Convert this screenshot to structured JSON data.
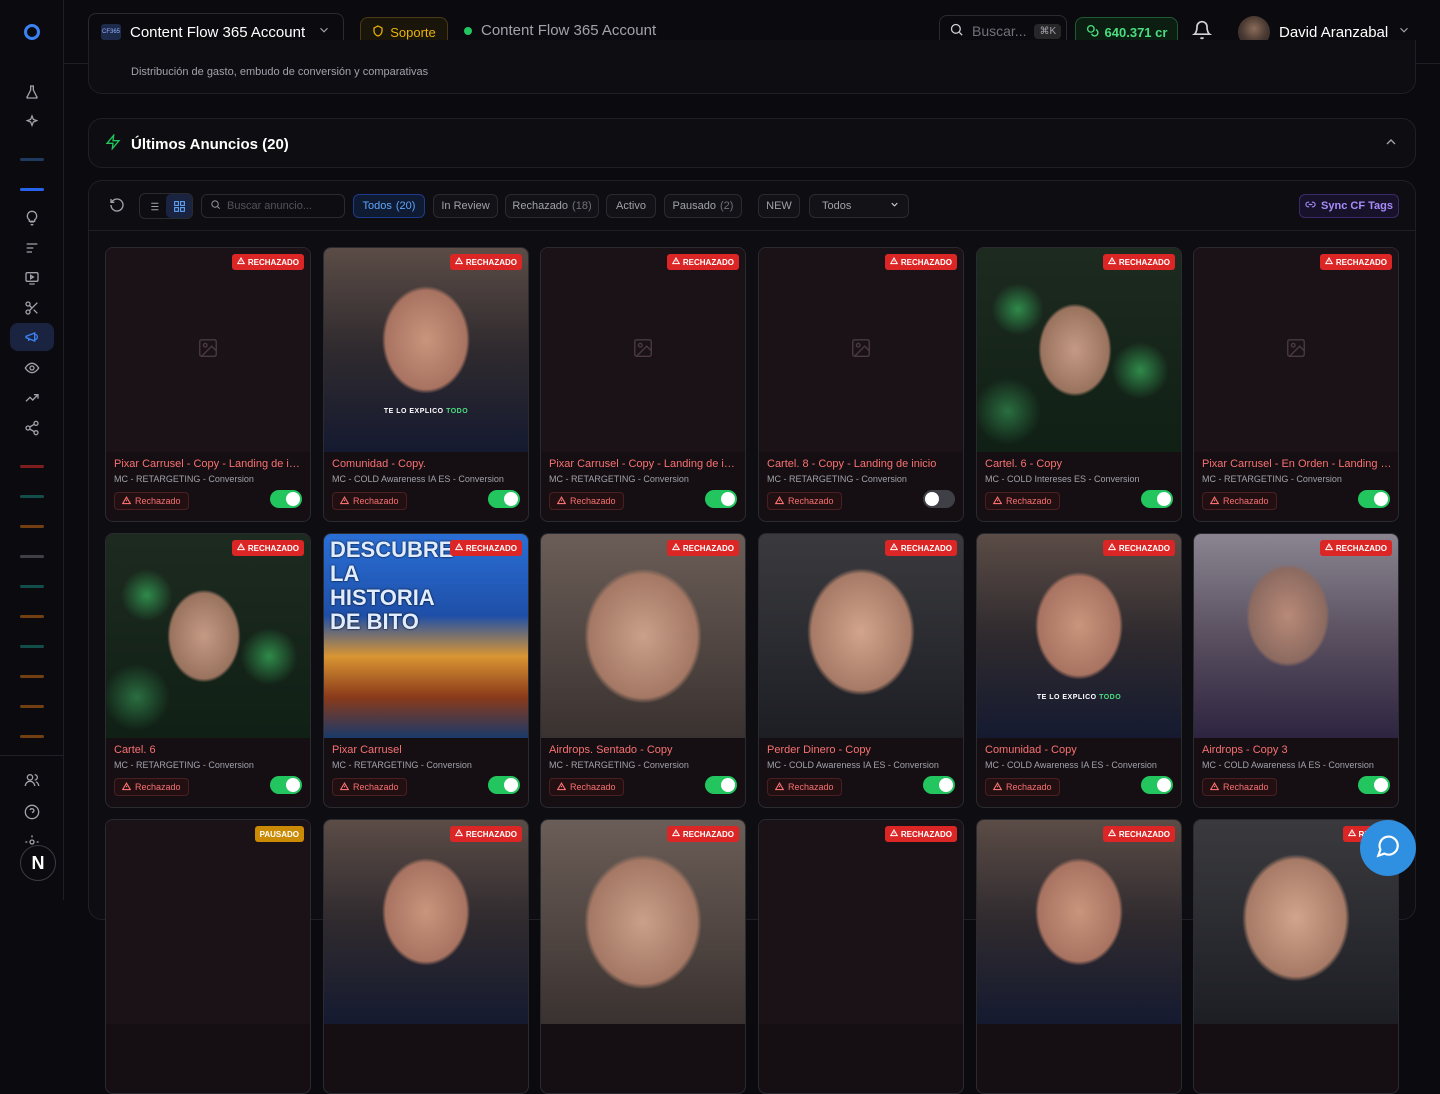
{
  "topbar": {
    "account_name": "Content Flow 365 Account",
    "account_logo_text": "CF365",
    "support_label": "Soporte",
    "account_status": "Content Flow 365 Account",
    "search_placeholder": "Buscar...",
    "search_shortcut": "⌘K",
    "credits": "640.371 cr",
    "user_name": "David Aranzabal"
  },
  "sidebar": {
    "avatar_initial": "N",
    "items": [
      "flask-icon",
      "sparkles-icon",
      "lightbulb-icon",
      "list-icon",
      "monitor-play-icon",
      "scissors-icon",
      "megaphone-icon",
      "eye-icon",
      "trending-icon",
      "share-icon",
      "users-icon",
      "help-icon",
      "settings-icon"
    ],
    "dash_colors": [
      "#1e3a5f",
      "#2563eb",
      "#7f1d1d",
      "#134e4a",
      "#713f12",
      "#3f3f46",
      "#134e4a",
      "#713f12",
      "#134e4a",
      "#713f12",
      "#713f12",
      "#713f12"
    ]
  },
  "prev_section": {
    "subtitle": "Distribución de gasto, embudo de conversión y comparativas"
  },
  "ads_section": {
    "title": "Últimos Anuncios (20)"
  },
  "filters": {
    "search_placeholder": "Buscar anuncio...",
    "tabs": [
      {
        "label": "Todos",
        "count": "(20)",
        "active": true
      },
      {
        "label": "In Review",
        "count": "",
        "active": false
      },
      {
        "label": "Rechazado",
        "count": "(18)",
        "active": false
      },
      {
        "label": "Activo",
        "count": "",
        "active": false
      },
      {
        "label": "Pausado",
        "count": "(2)",
        "active": false
      }
    ],
    "new_label": "NEW",
    "select_value": "Todos",
    "sync_label": "Sync CF Tags"
  },
  "status_labels": {
    "rejected_badge": "RECHAZADO",
    "paused_badge": "PAUSADO",
    "rejected_chip": "Rechazado"
  },
  "ads": [
    {
      "name": "Pixar Carrusel - Copy - Landing de in...",
      "campaign": "MC - RETARGETING - Conversion",
      "status": "Rechazado",
      "badge": "RECHAZADO",
      "enabled": true,
      "thumb": "placeholder",
      "caption": ""
    },
    {
      "name": "Comunidad - Copy.",
      "campaign": "MC - COLD Awareness IA ES - Conversion",
      "status": "Rechazado",
      "badge": "RECHAZADO",
      "enabled": true,
      "thumb": "video-a",
      "caption": "TE LO EXPLICO TODO"
    },
    {
      "name": "Pixar Carrusel - Copy - Landing de in...",
      "campaign": "MC - RETARGETING - Conversion",
      "status": "Rechazado",
      "badge": "RECHAZADO",
      "enabled": true,
      "thumb": "placeholder",
      "caption": ""
    },
    {
      "name": "Cartel. 8 - Copy - Landing de inicio",
      "campaign": "MC - RETARGETING - Conversion",
      "status": "Rechazado",
      "badge": "RECHAZADO",
      "enabled": false,
      "thumb": "placeholder",
      "caption": ""
    },
    {
      "name": "Cartel. 6 - Copy",
      "campaign": "MC - COLD Intereses ES - Conversion",
      "status": "Rechazado",
      "badge": "RECHAZADO",
      "enabled": true,
      "thumb": "video-b",
      "caption": ""
    },
    {
      "name": "Pixar Carrusel - En Orden - Landing d...",
      "campaign": "MC - RETARGETING - Conversion",
      "status": "Rechazado",
      "badge": "RECHAZADO",
      "enabled": true,
      "thumb": "placeholder",
      "caption": ""
    },
    {
      "name": "Cartel. 6",
      "campaign": "MC - RETARGETING - Conversion",
      "status": "Rechazado",
      "badge": "RECHAZADO",
      "enabled": true,
      "thumb": "video-b",
      "caption": ""
    },
    {
      "name": "Pixar Carrusel",
      "campaign": "MC - RETARGETING - Conversion",
      "status": "Rechazado",
      "badge": "RECHAZADO",
      "enabled": true,
      "thumb": "video-c",
      "caption": "DESCUBRE LA HISTORIA DE BITO"
    },
    {
      "name": "Airdrops. Sentado - Copy",
      "campaign": "MC - RETARGETING - Conversion",
      "status": "Rechazado",
      "badge": "RECHAZADO",
      "enabled": true,
      "thumb": "video-d",
      "caption": ""
    },
    {
      "name": "Perder Dinero - Copy",
      "campaign": "MC - COLD Awareness IA ES - Conversion",
      "status": "Rechazado",
      "badge": "RECHAZADO",
      "enabled": true,
      "thumb": "video-e",
      "caption": ""
    },
    {
      "name": "Comunidad - Copy",
      "campaign": "MC - COLD Awareness IA ES - Conversion",
      "status": "Rechazado",
      "badge": "RECHAZADO",
      "enabled": true,
      "thumb": "video-a",
      "caption": "TE LO EXPLICO TODO"
    },
    {
      "name": "Airdrops - Copy 3",
      "campaign": "MC - COLD Awareness IA ES - Conversion",
      "status": "Rechazado",
      "badge": "RECHAZADO",
      "enabled": true,
      "thumb": "video-f",
      "caption": ""
    },
    {
      "badge": "PAUSADO",
      "thumb": "empty"
    },
    {
      "badge": "RECHAZADO",
      "thumb": "video-a"
    },
    {
      "badge": "RECHAZADO",
      "thumb": "video-d"
    },
    {
      "badge": "RECHAZADO",
      "thumb": "empty"
    },
    {
      "badge": "RECHAZADO",
      "thumb": "video-a"
    },
    {
      "badge": "RECHA",
      "thumb": "video-e"
    }
  ]
}
